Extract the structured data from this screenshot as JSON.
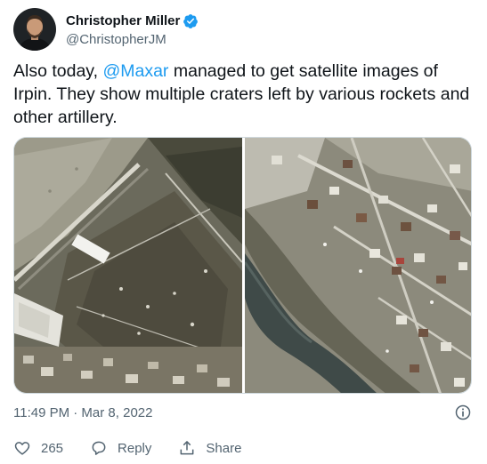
{
  "author": {
    "display_name": "Christopher Miller",
    "handle": "@ChristopherJM",
    "verified": true
  },
  "tweet": {
    "text_before": "Also today, ",
    "mention": "@Maxar",
    "text_after": " managed to get satellite images of Irpin. They show multiple craters left by various rockets and other artillery."
  },
  "media": {
    "photo_count": 2
  },
  "meta": {
    "timestamp": "11:49 PM · Mar 8, 2022"
  },
  "actions": {
    "like_count": "265",
    "reply_label": "Reply",
    "share_label": "Share"
  },
  "colors": {
    "accent": "#1d9bf0",
    "text_primary": "#0f1419",
    "text_secondary": "#536471"
  },
  "icons": {
    "verified": "verified-badge-icon",
    "info": "info-icon",
    "like": "heart-icon",
    "reply": "reply-bubble-icon",
    "share": "share-upload-icon"
  }
}
